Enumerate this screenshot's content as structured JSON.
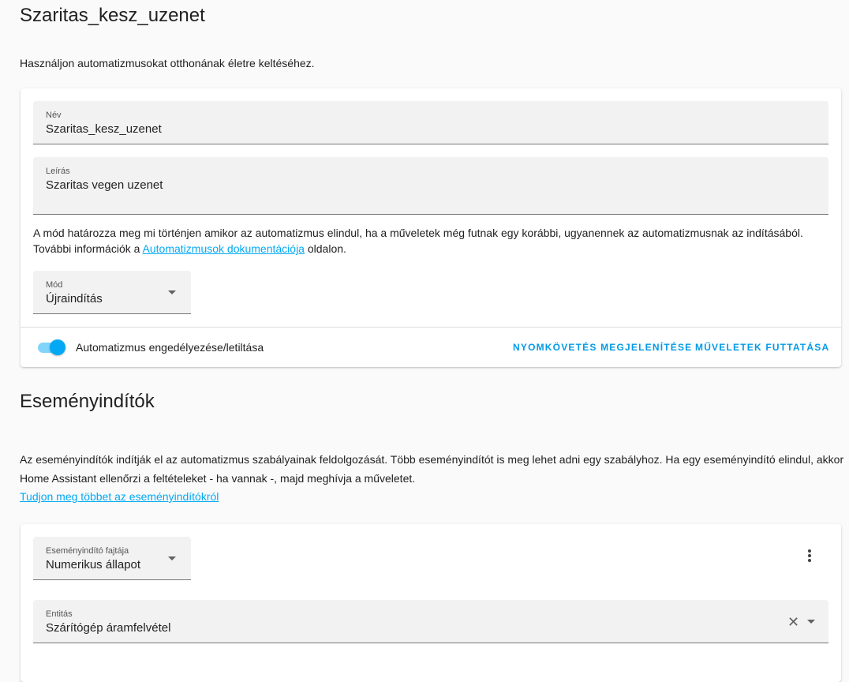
{
  "page": {
    "title": "Szaritas_kesz_uzenet",
    "intro": "Használjon automatizmusokat otthonának életre keltéséhez."
  },
  "details_card": {
    "name_label": "Név",
    "name_value": "Szaritas_kesz_uzenet",
    "description_label": "Leírás",
    "description_value": "Szaritas vegen uzenet",
    "mode_desc_before": "A mód határozza meg mi történjen amikor az automatizmus elindul, ha a műveletek még futnak egy korábbi, ugyanennek az automatizmusnak az indításából. További információk a ",
    "mode_desc_link": "Automatizmusok dokumentációja",
    "mode_desc_after": " oldalon.",
    "mode_label": "Mód",
    "mode_value": "Újraindítás",
    "toggle_label": "Automatizmus engedélyezése/letiltása",
    "toggle_on": true,
    "trace_button": "NYOMKÖVETÉS MEGJELENÍTÉSE",
    "run_button": "MŰVELETEK FUTTATÁSA"
  },
  "triggers": {
    "title": "Eseményindítók",
    "description": "Az eseményindítók indítják el az automatizmus szabályainak feldolgozását. Több eseményindítót is meg lehet adni egy szabályhoz. Ha egy eseményindító elindul, akkor Home Assistant ellenőrzi a feltételeket - ha vannak -, majd meghívja a műveletet.",
    "learn_more": "Tudjon meg többet az eseményindítókról",
    "trigger_type_label": "Eseményindító fajtája",
    "trigger_type_value": "Numerikus állapot",
    "entity_label": "Entitás",
    "entity_value": "Szárítógép áramfelvétel"
  },
  "colors": {
    "accent": "#03a9f4",
    "background": "#fafafa",
    "card": "#ffffff"
  }
}
